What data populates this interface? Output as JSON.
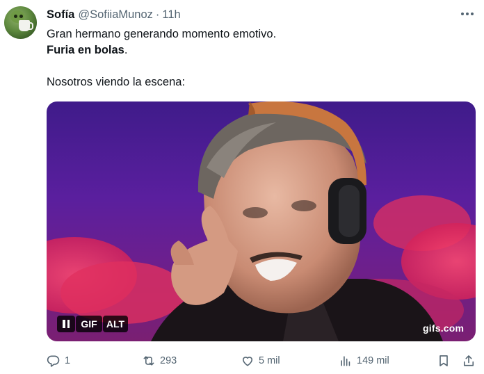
{
  "author": {
    "display_name": "Sofía",
    "handle": "@SofiiaMunoz",
    "separator": "·",
    "timestamp": "11h"
  },
  "text": {
    "line1": "Gran hermano generando momento emotivo.",
    "line2_bold": "Furia en bolas",
    "line2_tail": ".",
    "line3": "Nosotros viendo la escena:"
  },
  "media": {
    "type": "gif",
    "pause_label": "pause",
    "gif_badge": "GIF",
    "alt_badge": "ALT",
    "watermark": "gifs.com"
  },
  "actions": {
    "replies": "1",
    "reposts": "293",
    "likes": "5 mil",
    "views": "149 mil"
  },
  "colors": {
    "text_primary": "#0f1419",
    "text_secondary": "#536471",
    "media_bg": "#5a1f9e"
  },
  "icons": [
    "more-icon",
    "reply-icon",
    "repost-icon",
    "like-icon",
    "views-icon",
    "bookmark-icon",
    "share-icon",
    "pause-icon"
  ]
}
